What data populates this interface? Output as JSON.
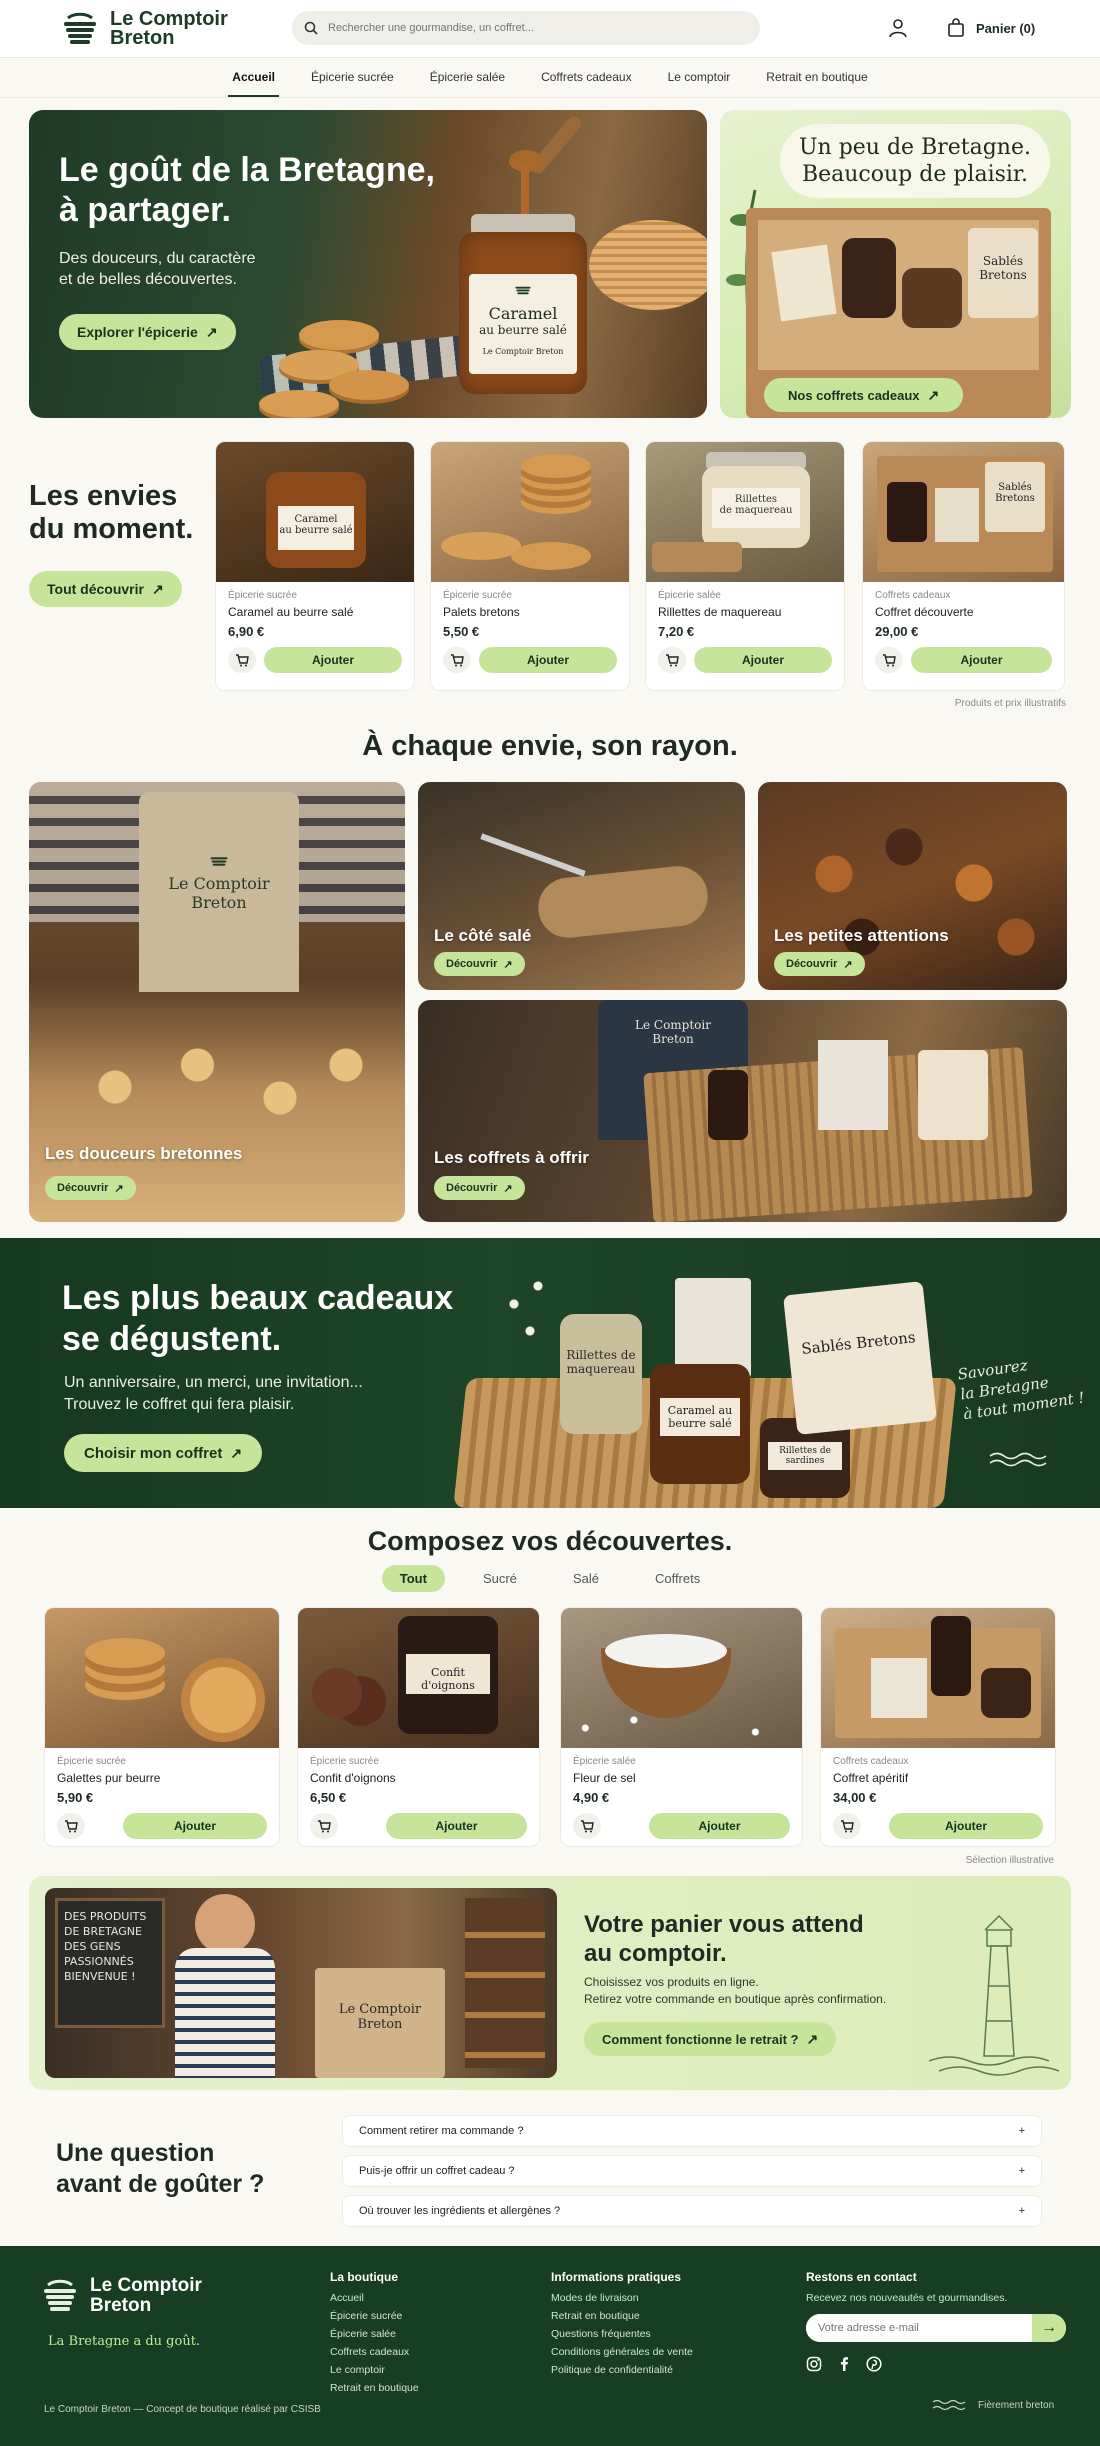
{
  "header": {
    "logo_line1": "Le Comptoir",
    "logo_line2": "Breton",
    "search_placeholder": "Rechercher une gourmandise, un coffret...",
    "cart_label": "Panier (0)"
  },
  "nav": [
    "Accueil",
    "Épicerie sucrée",
    "Épicerie salée",
    "Coffrets cadeaux",
    "Le comptoir",
    "Retrait en boutique"
  ],
  "hero": {
    "title_line1": "Le goût de la Bretagne,",
    "title_line2": "à partager.",
    "subtitle_line1": "Des douceurs, du caractère",
    "subtitle_line2": "et de belles découvertes.",
    "cta": "Explorer l'épicerie",
    "jar_label_line1": "Caramel",
    "jar_label_line2": "au beurre salé",
    "jar_label_brand": "Le Comptoir Breton"
  },
  "gift_card": {
    "title_line1": "Un peu de Bretagne.",
    "title_line2": "Beaucoup de plaisir.",
    "cta": "Nos coffrets cadeaux",
    "box_label_line1": "Sablés",
    "box_label_line2": "Bretons"
  },
  "envies": {
    "title_line1": "Les envies",
    "title_line2": "du moment.",
    "cta": "Tout découvrir",
    "note": "Produits et prix illustratifs",
    "add_label": "Ajouter",
    "products": [
      {
        "category": "Épicerie sucrée",
        "name": "Caramel au beurre salé",
        "price": "6,90 €",
        "img_line1": "Caramel",
        "img_line2": "au beurre salé"
      },
      {
        "category": "Épicerie sucrée",
        "name": "Palets bretons",
        "price": "5,50 €",
        "img_line1": "",
        "img_line2": ""
      },
      {
        "category": "Épicerie salée",
        "name": "Rillettes de maquereau",
        "price": "7,20 €",
        "img_line1": "Rillettes",
        "img_line2": "de maquereau"
      },
      {
        "category": "Coffrets cadeaux",
        "name": "Coffret découverte",
        "price": "29,00 €",
        "img_line1": "Sablés",
        "img_line2": "Bretons"
      }
    ]
  },
  "rayons": {
    "title": "À chaque envie, son rayon.",
    "cta": "Découvrir",
    "tiles": [
      {
        "label": "Les douceurs bretonnes",
        "apron_line1": "Le Comptoir",
        "apron_line2": "Breton"
      },
      {
        "label": "Le côté salé"
      },
      {
        "label": "Les petites attentions"
      },
      {
        "label": "Les coffrets à offrir",
        "apron_line1": "Le Comptoir",
        "apron_line2": "Breton"
      }
    ]
  },
  "banner": {
    "title_line1": "Les plus beaux cadeaux",
    "title_line2": "se dégustent.",
    "text_line1": "Un anniversaire, un merci, une invitation...",
    "text_line2": "Trouvez le coffret qui fera plaisir.",
    "cta": "Choisir mon coffret",
    "script_line1": "Savourez",
    "script_line2": "la Bretagne",
    "script_line3": "à tout moment !",
    "jars": [
      "Rillettes de maquereau",
      "Caramel au beurre salé",
      "Rillettes de sardines",
      "Sablés Bretons"
    ]
  },
  "compose": {
    "title": "Composez vos découvertes.",
    "tabs": [
      "Tout",
      "Sucré",
      "Salé",
      "Coffrets"
    ],
    "add_label": "Ajouter",
    "note": "Sélection illustrative",
    "products": [
      {
        "category": "Épicerie sucrée",
        "name": "Galettes pur beurre",
        "price": "5,90 €",
        "img_line1": "",
        "img_line2": ""
      },
      {
        "category": "Épicerie sucrée",
        "name": "Confit d'oignons",
        "price": "6,50 €",
        "img_line1": "Confit d'oignons",
        "img_line2": ""
      },
      {
        "category": "Épicerie salée",
        "name": "Fleur de sel",
        "price": "4,90 €",
        "img_line1": "",
        "img_line2": ""
      },
      {
        "category": "Coffrets cadeaux",
        "name": "Coffret apéritif",
        "price": "34,00 €",
        "img_line1": "",
        "img_line2": ""
      }
    ]
  },
  "pickup": {
    "chalkboard": [
      "DES PRODUITS",
      "DE BRETAGNE",
      "DES GENS",
      "PASSIONNÉS",
      "BIENVENUE !"
    ],
    "bag_line1": "Le Comptoir",
    "bag_line2": "Breton",
    "title_line1": "Votre panier vous attend",
    "title_line2": "au comptoir.",
    "text_line1": "Choisissez vos produits en ligne.",
    "text_line2": "Retirez votre commande en boutique après confirmation.",
    "cta": "Comment fonctionne le retrait ?"
  },
  "faq": {
    "title_line1": "Une question",
    "title_line2": "avant de goûter ?",
    "items": [
      "Comment retirer ma commande ?",
      "Puis-je offrir un coffret cadeau ?",
      "Où trouver les ingrédients et allergènes ?"
    ]
  },
  "footer": {
    "logo_line1": "Le Comptoir",
    "logo_line2": "Breton",
    "tagline": "La Bretagne a du goût.",
    "col1_title": "La boutique",
    "col1_links": [
      "Accueil",
      "Épicerie sucrée",
      "Épicerie salée",
      "Coffrets cadeaux",
      "Le comptoir",
      "Retrait en boutique"
    ],
    "col2_title": "Informations pratiques",
    "col2_links": [
      "Modes de livraison",
      "Retrait en boutique",
      "Questions fréquentes",
      "Conditions générales de vente",
      "Politique de confidentialité"
    ],
    "col3_title": "Restons en contact",
    "col3_text": "Recevez nos nouveautés et gourmandises.",
    "email_placeholder": "Votre adresse e-mail",
    "copyright": "Le Comptoir Breton — Concept de boutique réalisé par CSISB",
    "right_note": "Fièrement breton"
  },
  "colors": {
    "green_dark": "#173d22",
    "green_light": "#c6e59a",
    "cream": "#faf8f2"
  }
}
